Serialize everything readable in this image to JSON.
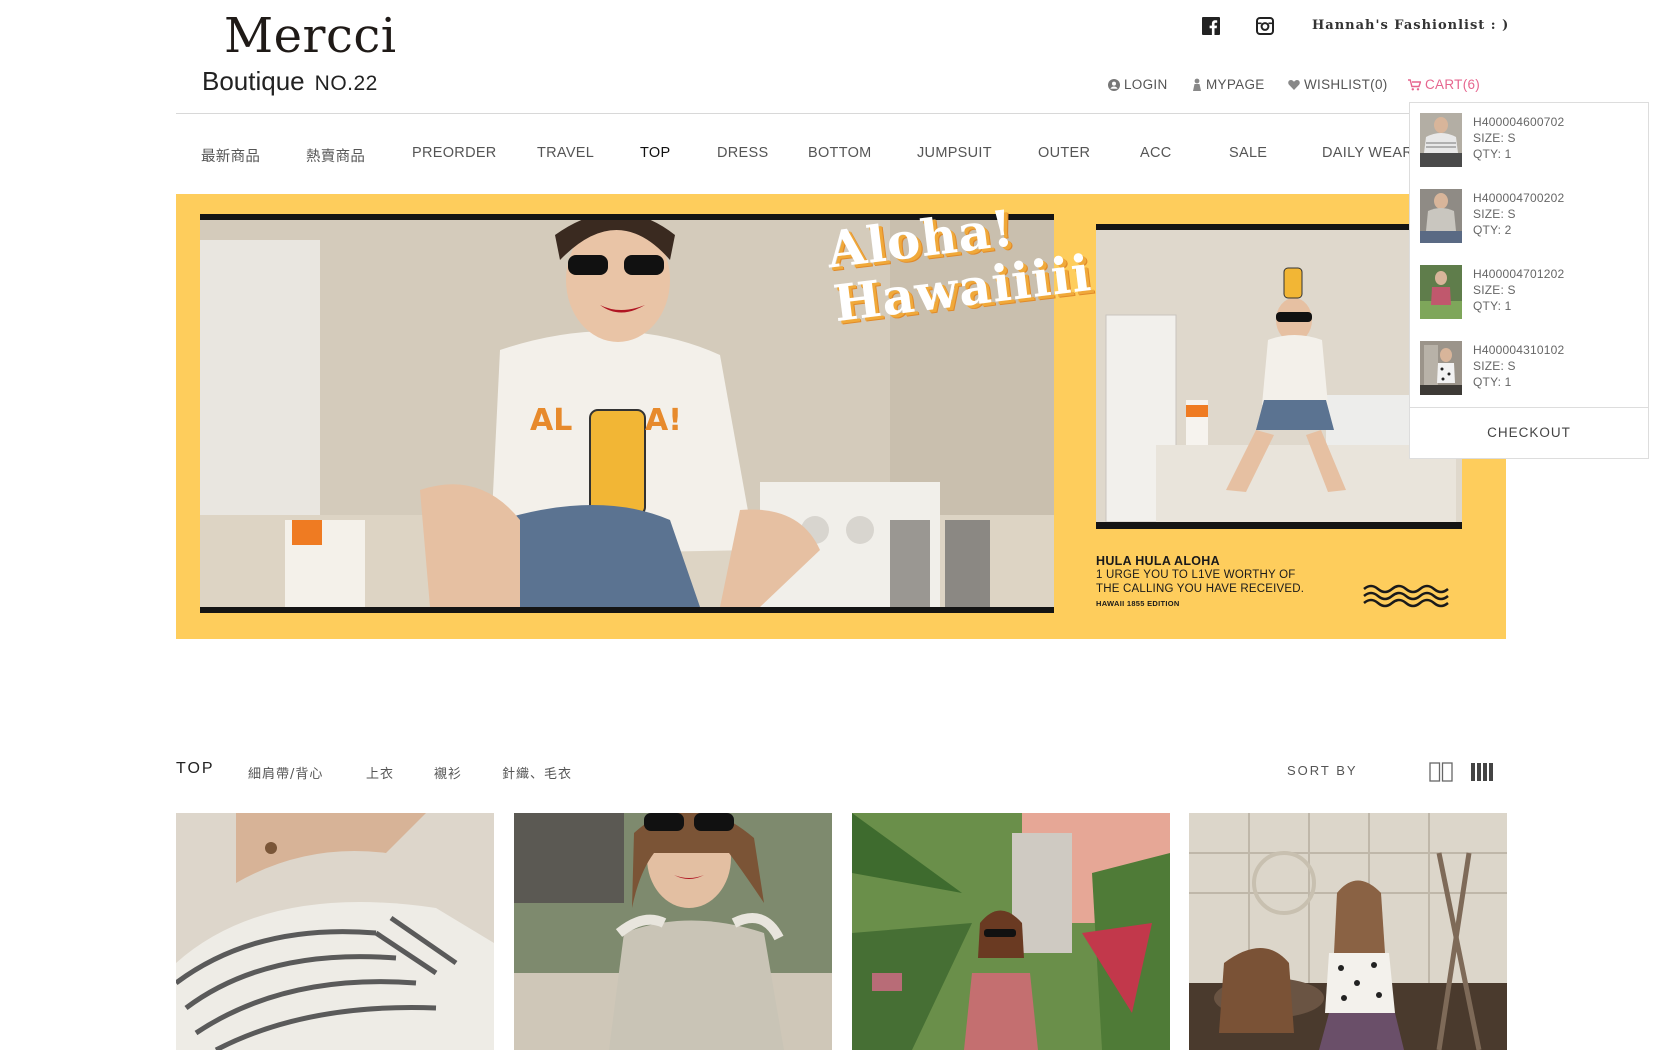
{
  "brand": {
    "name": "Mercci",
    "subtitle": "Boutique",
    "number": "NO.22"
  },
  "header": {
    "social": [
      "facebook-icon",
      "instagram-icon"
    ],
    "fashionlist": "Hannah's  Fashionlist  : )",
    "login": "LOGIN",
    "mypage": "MYPAGE",
    "wishlist": "WISHLIST(0)",
    "cart": "CART(6)",
    "cart_color": "#e6668f"
  },
  "categories": [
    "最新商品",
    "熱賣商品",
    "PREORDER",
    "TRAVEL",
    "TOP",
    "DRESS",
    "BOTTOM",
    "JUMPSUIT",
    "OUTER",
    "ACC",
    "SALE",
    "DAILY WEAR"
  ],
  "active_category": "TOP",
  "banner": {
    "headline_1": "Aloha!",
    "headline_2": "Hawaiiiii",
    "shirt_text_1": "AL",
    "shirt_text_2": "A!",
    "copy_title": "HULA HULA ALOHA",
    "copy_line1": "1 URGE YOU TO L1VE WORTHY OF",
    "copy_line2": "THE CALLING YOU HAVE RECEIVED.",
    "copy_edition": "HAWAII 1855 EDITION",
    "bg_color": "#fecd5c"
  },
  "cart_dropdown": {
    "items": [
      {
        "code": "H400004600702",
        "size": "SIZE: S",
        "qty": "QTY: 1"
      },
      {
        "code": "H400004700202",
        "size": "SIZE: S",
        "qty": "QTY: 2"
      },
      {
        "code": "H400004701202",
        "size": "SIZE: S",
        "qty": "QTY: 1"
      },
      {
        "code": "H400004310102",
        "size": "SIZE: S",
        "qty": "QTY: 1"
      }
    ],
    "checkout": "CHECKOUT"
  },
  "listing": {
    "title": "TOP",
    "subcategories": [
      "細肩帶/背心",
      "上衣",
      "襯衫",
      "針織、毛衣"
    ],
    "sort_label": "SORT BY",
    "view_icons": [
      "grid-2-icon",
      "grid-4-icon"
    ]
  },
  "products": [
    {
      "name": "striped-off-shoulder-top"
    },
    {
      "name": "ruffle-sleeveless-top"
    },
    {
      "name": "rose-sleeveless-top"
    },
    {
      "name": "polka-dot-blouse"
    }
  ]
}
